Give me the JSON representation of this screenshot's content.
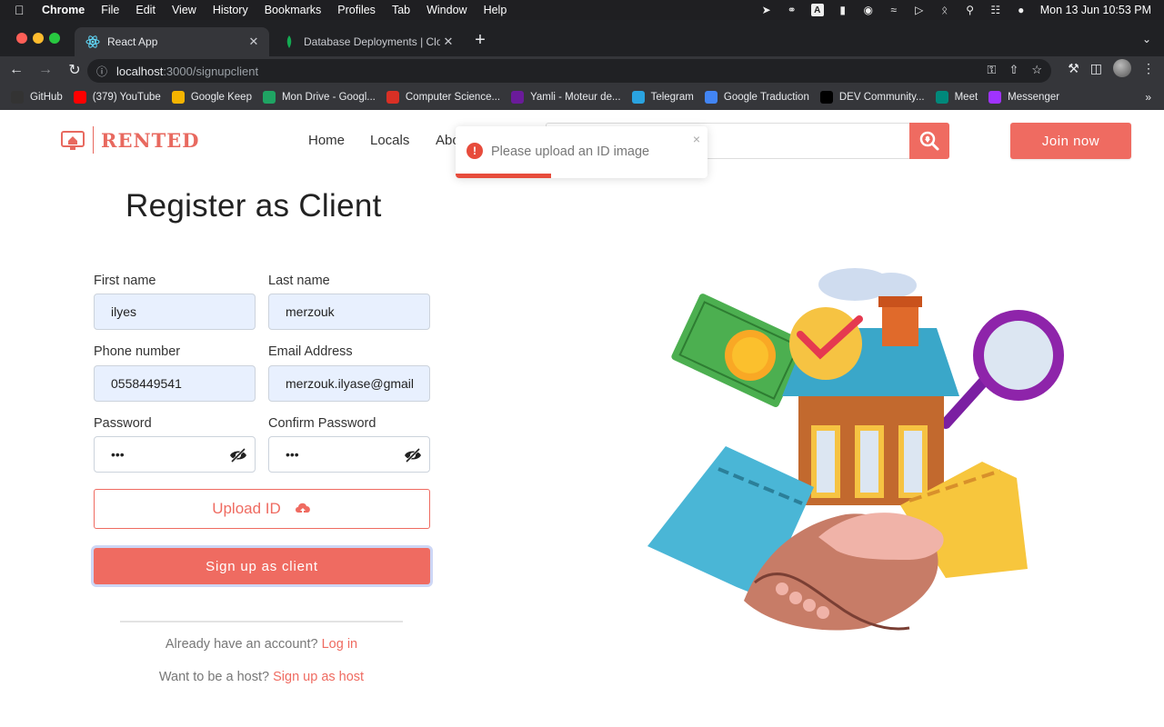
{
  "menubar": {
    "app": "Chrome",
    "items": [
      "File",
      "Edit",
      "View",
      "History",
      "Bookmarks",
      "Profiles",
      "Tab",
      "Window",
      "Help"
    ],
    "datetime": "Mon 13 Jun  10:53 PM"
  },
  "browser": {
    "tabs": [
      {
        "title": "React App",
        "active": true
      },
      {
        "title": "Database Deployments | Cloud",
        "active": false
      }
    ],
    "url_host": "localhost",
    "url_path": ":3000/signupclient",
    "bookmarks": [
      {
        "label": "GitHub",
        "icon": "github-icon",
        "color": "#333333"
      },
      {
        "label": "(379) YouTube",
        "icon": "youtube-icon",
        "color": "#ff0000"
      },
      {
        "label": "Google Keep",
        "icon": "keep-icon",
        "color": "#f4b400"
      },
      {
        "label": "Mon Drive - Googl...",
        "icon": "drive-icon",
        "color": "#1fa463"
      },
      {
        "label": "Computer Science...",
        "icon": "cs-icon",
        "color": "#d93025"
      },
      {
        "label": "Yamli - Moteur de...",
        "icon": "yamli-icon",
        "color": "#6a1b9a"
      },
      {
        "label": "Telegram",
        "icon": "telegram-icon",
        "color": "#2aa3e0"
      },
      {
        "label": "Google Traduction",
        "icon": "translate-icon",
        "color": "#4285f4"
      },
      {
        "label": "DEV Community...",
        "icon": "dev-icon",
        "color": "#000000"
      },
      {
        "label": "Meet",
        "icon": "meet-icon",
        "color": "#00897b"
      },
      {
        "label": "Messenger",
        "icon": "messenger-icon",
        "color": "#a033ff"
      }
    ]
  },
  "site": {
    "brand": "RENTED",
    "nav": [
      "Home",
      "Locals",
      "Abo"
    ],
    "join_label": "Join now",
    "accent": "#ef6b61"
  },
  "toast": {
    "message": "Please upload an ID image",
    "close": "×",
    "progress": 0.38,
    "color": "#e74c3c"
  },
  "form": {
    "title": "Register as Client",
    "first_name": {
      "label": "First name",
      "value": "ilyes"
    },
    "last_name": {
      "label": "Last name",
      "value": "merzouk"
    },
    "phone": {
      "label": "Phone number",
      "value": "0558449541"
    },
    "email": {
      "label": "Email Address",
      "value": "merzouk.ilyase@gmail"
    },
    "password": {
      "label": "Password",
      "value": "•••"
    },
    "confirm_password": {
      "label": "Confirm Password",
      "value": "•••"
    },
    "upload_label": "Upload ID",
    "submit_label": "Sign up as client"
  },
  "footer": {
    "login_prompt": "Already have an account?",
    "login_link": "Log in",
    "host_prompt": "Want to be a host?",
    "host_link": "Sign up as host"
  }
}
